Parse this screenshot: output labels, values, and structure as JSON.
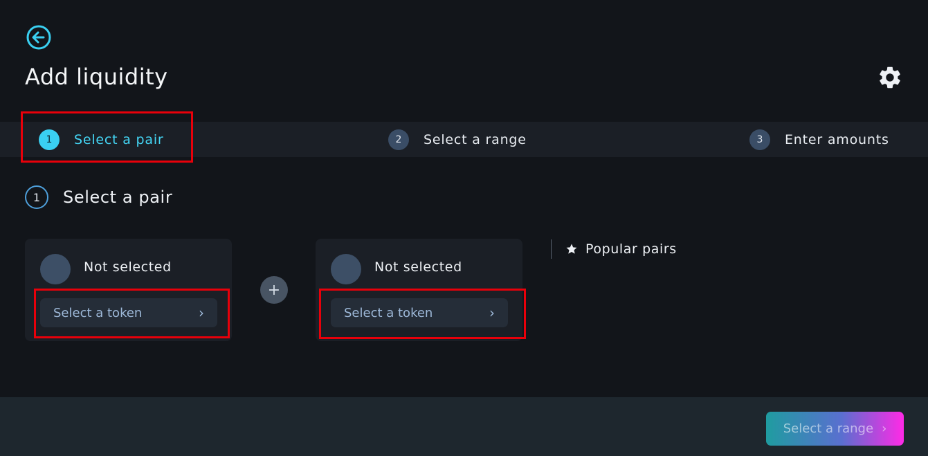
{
  "header": {
    "title": "Add liquidity",
    "back_icon": "arrow-left-circle-icon",
    "settings_icon": "gear-icon"
  },
  "stepper": {
    "steps": [
      {
        "num": "1",
        "label": "Select a pair",
        "active": true
      },
      {
        "num": "2",
        "label": "Select a range",
        "active": false
      },
      {
        "num": "3",
        "label": "Enter amounts",
        "active": false
      }
    ]
  },
  "section": {
    "num": "1",
    "title": "Select a pair"
  },
  "tokens": [
    {
      "status": "Not selected",
      "button": "Select a token"
    },
    {
      "status": "Not selected",
      "button": "Select a token"
    }
  ],
  "popular": {
    "label": "Popular pairs",
    "icon": "star-icon"
  },
  "footer": {
    "next_label": "Select a range"
  },
  "colors": {
    "accent": "#3ad0f2",
    "background": "#12151a",
    "panel": "#1b1f26",
    "highlight": "#e8000a",
    "gradient_start": "#1f9ca0",
    "gradient_end": "#ff2ae6"
  }
}
